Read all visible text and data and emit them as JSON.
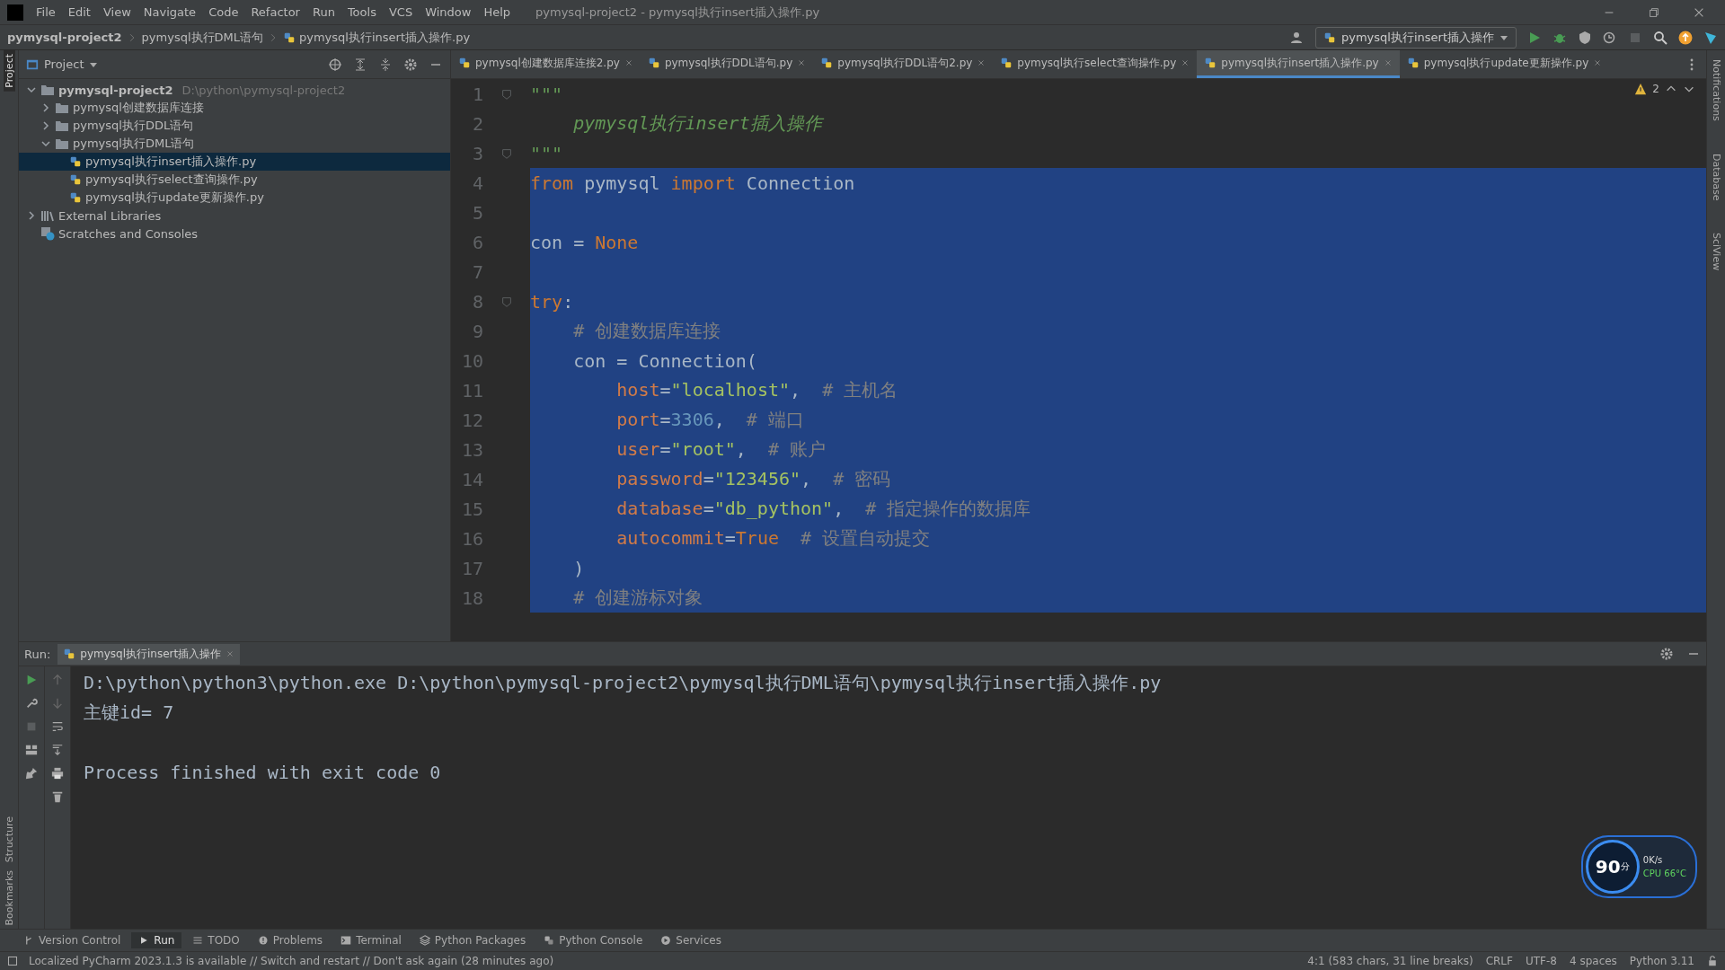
{
  "menu_bar": {
    "menus": [
      "File",
      "Edit",
      "View",
      "Navigate",
      "Code",
      "Refactor",
      "Run",
      "Tools",
      "VCS",
      "Window",
      "Help"
    ],
    "window_title": "pymysql-project2 - pymysql执行insert插入操作.py"
  },
  "breadcrumb": [
    {
      "kind": "project",
      "text": "pymysql-project2"
    },
    {
      "kind": "folder",
      "text": "pymysql执行DML语句"
    },
    {
      "kind": "file",
      "text": "pymysql执行insert插入操作.py"
    }
  ],
  "run_config": "pymysql执行insert插入操作",
  "left_stripe": {
    "top": [
      {
        "label": "Project",
        "selected": true
      }
    ],
    "bottom": [
      {
        "label": "Structure",
        "selected": false
      },
      {
        "label": "Bookmarks",
        "selected": false
      }
    ]
  },
  "right_stripe": [
    {
      "label": "Notifications",
      "selected": false
    },
    {
      "label": "Database",
      "selected": false
    },
    {
      "label": "SciView",
      "selected": false
    }
  ],
  "project_panel": {
    "title": "Project",
    "tree": [
      {
        "kind": "project",
        "label": "pymysql-project2",
        "path": "D:\\python\\pymysql-project2",
        "expanded": true,
        "selected": false,
        "children": [
          {
            "kind": "folder",
            "label": "pymysql创建数据库连接",
            "expanded": false,
            "selected": false
          },
          {
            "kind": "folder",
            "label": "pymysql执行DDL语句",
            "expanded": false,
            "selected": false
          },
          {
            "kind": "folder",
            "label": "pymysql执行DML语句",
            "expanded": true,
            "selected": false,
            "children": [
              {
                "kind": "file",
                "label": "pymysql执行insert插入操作.py",
                "selected": true
              },
              {
                "kind": "file",
                "label": "pymysql执行select查询操作.py",
                "selected": false
              },
              {
                "kind": "file",
                "label": "pymysql执行update更新操作.py",
                "selected": false
              }
            ]
          }
        ]
      },
      {
        "kind": "libraries",
        "label": "External Libraries",
        "expanded": false,
        "selected": false
      },
      {
        "kind": "scratches",
        "label": "Scratches and Consoles",
        "selected": false
      }
    ]
  },
  "editor_tabs": [
    {
      "label": "pymysql创建数据库连接2.py",
      "selected": false
    },
    {
      "label": "pymysql执行DDL语句.py",
      "selected": false
    },
    {
      "label": "pymysql执行DDL语句2.py",
      "selected": false
    },
    {
      "label": "pymysql执行select查询操作.py",
      "selected": false
    },
    {
      "label": "pymysql执行insert插入操作.py",
      "selected": true
    },
    {
      "label": "pymysql执行update更新操作.py",
      "selected": false
    }
  ],
  "warnings": "2",
  "code": [
    {
      "number": "1",
      "selected": false,
      "fold": true,
      "tokens": [
        {
          "kind": "doc",
          "text": "\"\"\""
        }
      ]
    },
    {
      "number": "2",
      "selected": false,
      "fold": false,
      "tokens": [
        {
          "kind": "doc",
          "text": "    pymysql执行insert插入操作"
        }
      ]
    },
    {
      "number": "3",
      "selected": false,
      "fold": true,
      "tokens": [
        {
          "kind": "doc",
          "text": "\"\"\""
        }
      ]
    },
    {
      "number": "4",
      "selected": true,
      "fold": false,
      "tokens": [
        {
          "kind": "kw",
          "text": "from"
        },
        {
          "kind": "plain",
          "text": " pymysql "
        },
        {
          "kind": "kw",
          "text": "import"
        },
        {
          "kind": "plain",
          "text": " Connection"
        }
      ]
    },
    {
      "number": "5",
      "selected": true,
      "fold": false
    },
    {
      "number": "6",
      "selected": true,
      "fold": false,
      "tokens": [
        {
          "kind": "plain",
          "text": "con = "
        },
        {
          "kind": "kw",
          "text": "None"
        }
      ]
    },
    {
      "number": "7",
      "selected": true,
      "fold": false
    },
    {
      "number": "8",
      "selected": true,
      "fold": true,
      "tokens": [
        {
          "kind": "kw",
          "text": "try"
        },
        {
          "kind": "plain",
          "text": ":"
        }
      ]
    },
    {
      "number": "9",
      "selected": true,
      "fold": false,
      "tokens": [
        {
          "kind": "comment",
          "text": "    # 创建数据库连接"
        }
      ]
    },
    {
      "number": "10",
      "selected": true,
      "fold": false,
      "tokens": [
        {
          "kind": "plain",
          "text": "    con = Connection("
        }
      ]
    },
    {
      "number": "11",
      "selected": true,
      "fold": false,
      "tokens": [
        {
          "kind": "param",
          "text": "        host"
        },
        {
          "kind": "plain",
          "text": "="
        },
        {
          "kind": "str",
          "text": "\"localhost\""
        },
        {
          "kind": "plain",
          "text": ","
        },
        {
          "kind": "comment",
          "text": "  # 主机名"
        }
      ]
    },
    {
      "number": "12",
      "selected": true,
      "fold": false,
      "tokens": [
        {
          "kind": "param",
          "text": "        port"
        },
        {
          "kind": "plain",
          "text": "="
        },
        {
          "kind": "num",
          "text": "3306"
        },
        {
          "kind": "plain",
          "text": ","
        },
        {
          "kind": "comment",
          "text": "  # 端口"
        }
      ]
    },
    {
      "number": "13",
      "selected": true,
      "fold": false,
      "tokens": [
        {
          "kind": "param",
          "text": "        user"
        },
        {
          "kind": "plain",
          "text": "="
        },
        {
          "kind": "str",
          "text": "\"root\""
        },
        {
          "kind": "plain",
          "text": ","
        },
        {
          "kind": "comment",
          "text": "  # 账户"
        }
      ]
    },
    {
      "number": "14",
      "selected": true,
      "fold": false,
      "tokens": [
        {
          "kind": "param",
          "text": "        password"
        },
        {
          "kind": "plain",
          "text": "="
        },
        {
          "kind": "str",
          "text": "\"123456\""
        },
        {
          "kind": "plain",
          "text": ","
        },
        {
          "kind": "comment",
          "text": "  # 密码"
        }
      ]
    },
    {
      "number": "15",
      "selected": true,
      "fold": false,
      "tokens": [
        {
          "kind": "param",
          "text": "        database"
        },
        {
          "kind": "plain",
          "text": "="
        },
        {
          "kind": "str",
          "text": "\"db_python\""
        },
        {
          "kind": "plain",
          "text": ","
        },
        {
          "kind": "comment",
          "text": "  # 指定操作的数据库"
        }
      ]
    },
    {
      "number": "16",
      "selected": true,
      "fold": false,
      "tokens": [
        {
          "kind": "param",
          "text": "        autocommit"
        },
        {
          "kind": "plain",
          "text": "="
        },
        {
          "kind": "kw",
          "text": "True"
        },
        {
          "kind": "comment",
          "text": "  # 设置自动提交"
        }
      ]
    },
    {
      "number": "17",
      "selected": true,
      "fold": false,
      "tokens": [
        {
          "kind": "plain",
          "text": "    )"
        }
      ]
    },
    {
      "number": "18",
      "selected": true,
      "fold": false,
      "tokens": [
        {
          "kind": "comment",
          "text": "    # 创建游标对象"
        }
      ]
    }
  ],
  "run_panel": {
    "label": "Run:",
    "tab": "pymysql执行insert插入操作",
    "output_blocks": [
      [
        "D:\\python\\python3\\python.exe D:\\python\\pymysql-project2\\pymysql执行DML语句\\pymysql执行insert插入操作.py",
        "主键id= 7"
      ],
      [
        "Process finished with exit code 0"
      ]
    ]
  },
  "monitor_widget": {
    "score": "90",
    "unit": "分",
    "speed": "0K/s",
    "cpu": "CPU 66°C"
  },
  "tool_tabs": [
    {
      "label": "Version Control",
      "selected": false
    },
    {
      "label": "Run",
      "selected": true
    },
    {
      "label": "TODO",
      "selected": false
    },
    {
      "label": "Problems",
      "selected": false
    },
    {
      "label": "Terminal",
      "selected": false
    },
    {
      "label": "Python Packages",
      "selected": false
    },
    {
      "label": "Python Console",
      "selected": false
    },
    {
      "label": "Services",
      "selected": false
    }
  ],
  "status_bar": {
    "message": "Localized PyCharm 2023.1.3 is available // Switch and restart // Don't ask again (28 minutes ago)",
    "items": [
      "4:1 (583 chars, 31 line breaks)",
      "CRLF",
      "UTF-8",
      "4 spaces",
      "Python 3.11"
    ]
  }
}
